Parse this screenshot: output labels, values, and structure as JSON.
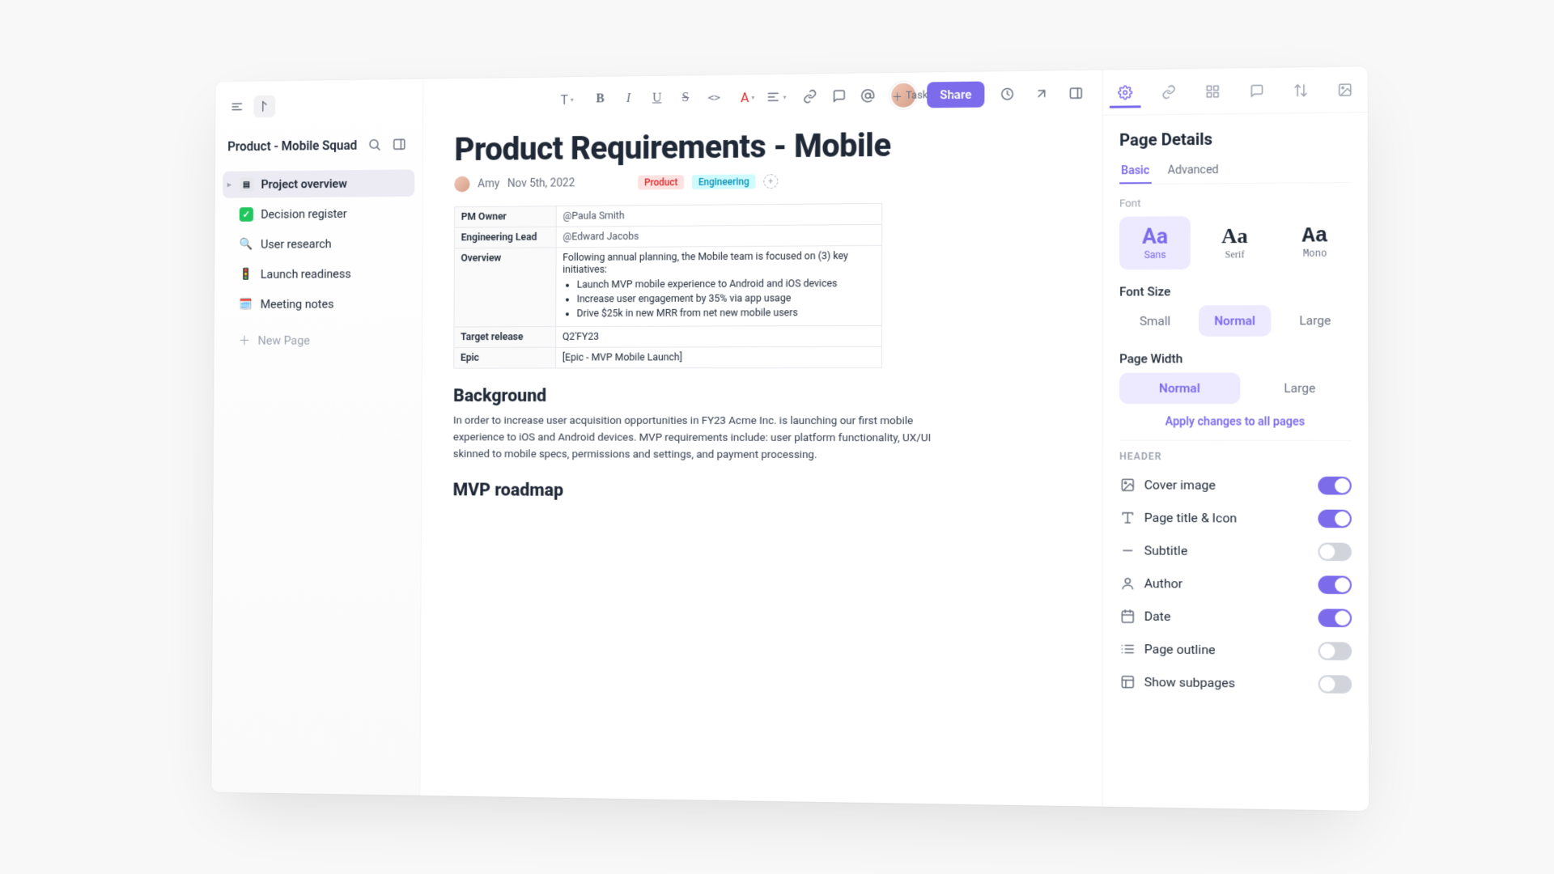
{
  "topbar": {
    "task_label": "Task",
    "share_label": "Share"
  },
  "sidebar": {
    "workspace_name": "Product - Mobile Squad",
    "new_page_label": "New Page",
    "items": [
      {
        "label": "Project overview",
        "icon": "doc"
      },
      {
        "label": "Decision register",
        "icon": "check"
      },
      {
        "label": "User research",
        "icon": "search"
      },
      {
        "label": "Launch readiness",
        "icon": "traffic"
      },
      {
        "label": "Meeting notes",
        "icon": "calendar"
      }
    ]
  },
  "doc": {
    "title": "Product Requirements - Mobile",
    "author_name": "Amy",
    "date": "Nov 5th, 2022",
    "tags": {
      "product": "Product",
      "engineering": "Engineering"
    },
    "table": {
      "pm_owner_label": "PM Owner",
      "pm_owner_value": "@Paula Smith",
      "eng_lead_label": "Engineering Lead",
      "eng_lead_value": "@Edward Jacobs",
      "overview_label": "Overview",
      "overview_intro": "Following annual planning, the Mobile team is focused on (3) key initiatives:",
      "overview_items": [
        "Launch MVP mobile experience to Android and iOS devices",
        "Increase user engagement by 35% via app usage",
        "Drive $25k in new MRR from net new mobile users"
      ],
      "target_release_label": "Target release",
      "target_release_value": "Q2'FY23",
      "epic_label": "Epic",
      "epic_value": "[Epic - MVP Mobile Launch]"
    },
    "background_heading": "Background",
    "background_text": "In order to increase user acquisition opportunities in FY23 Acme Inc. is launching our first mobile experience to iOS and Android devices. MVP requirements include: user platform functionality, UX/UI skinned to mobile specs, permissions and settings, and payment processing.",
    "roadmap_heading": "MVP roadmap"
  },
  "rightpanel": {
    "title": "Page Details",
    "subtabs": {
      "basic": "Basic",
      "advanced": "Advanced"
    },
    "font_label": "Font",
    "fonts": {
      "sans": "Sans",
      "serif": "Serif",
      "mono": "Mono"
    },
    "font_size_label": "Font Size",
    "sizes": {
      "small": "Small",
      "normal": "Normal",
      "large": "Large"
    },
    "page_width_label": "Page Width",
    "widths": {
      "normal": "Normal",
      "large": "Large"
    },
    "apply_label": "Apply changes to all pages",
    "header_label": "HEADER",
    "toggles": [
      {
        "label": "Cover image",
        "icon": "image",
        "on": true
      },
      {
        "label": "Page title & Icon",
        "icon": "type",
        "on": true
      },
      {
        "label": "Subtitle",
        "icon": "minus",
        "on": false
      },
      {
        "label": "Author",
        "icon": "user",
        "on": true
      },
      {
        "label": "Date",
        "icon": "calendar",
        "on": true
      },
      {
        "label": "Page outline",
        "icon": "list",
        "on": false
      },
      {
        "label": "Show subpages",
        "icon": "layout",
        "on": false
      }
    ]
  }
}
